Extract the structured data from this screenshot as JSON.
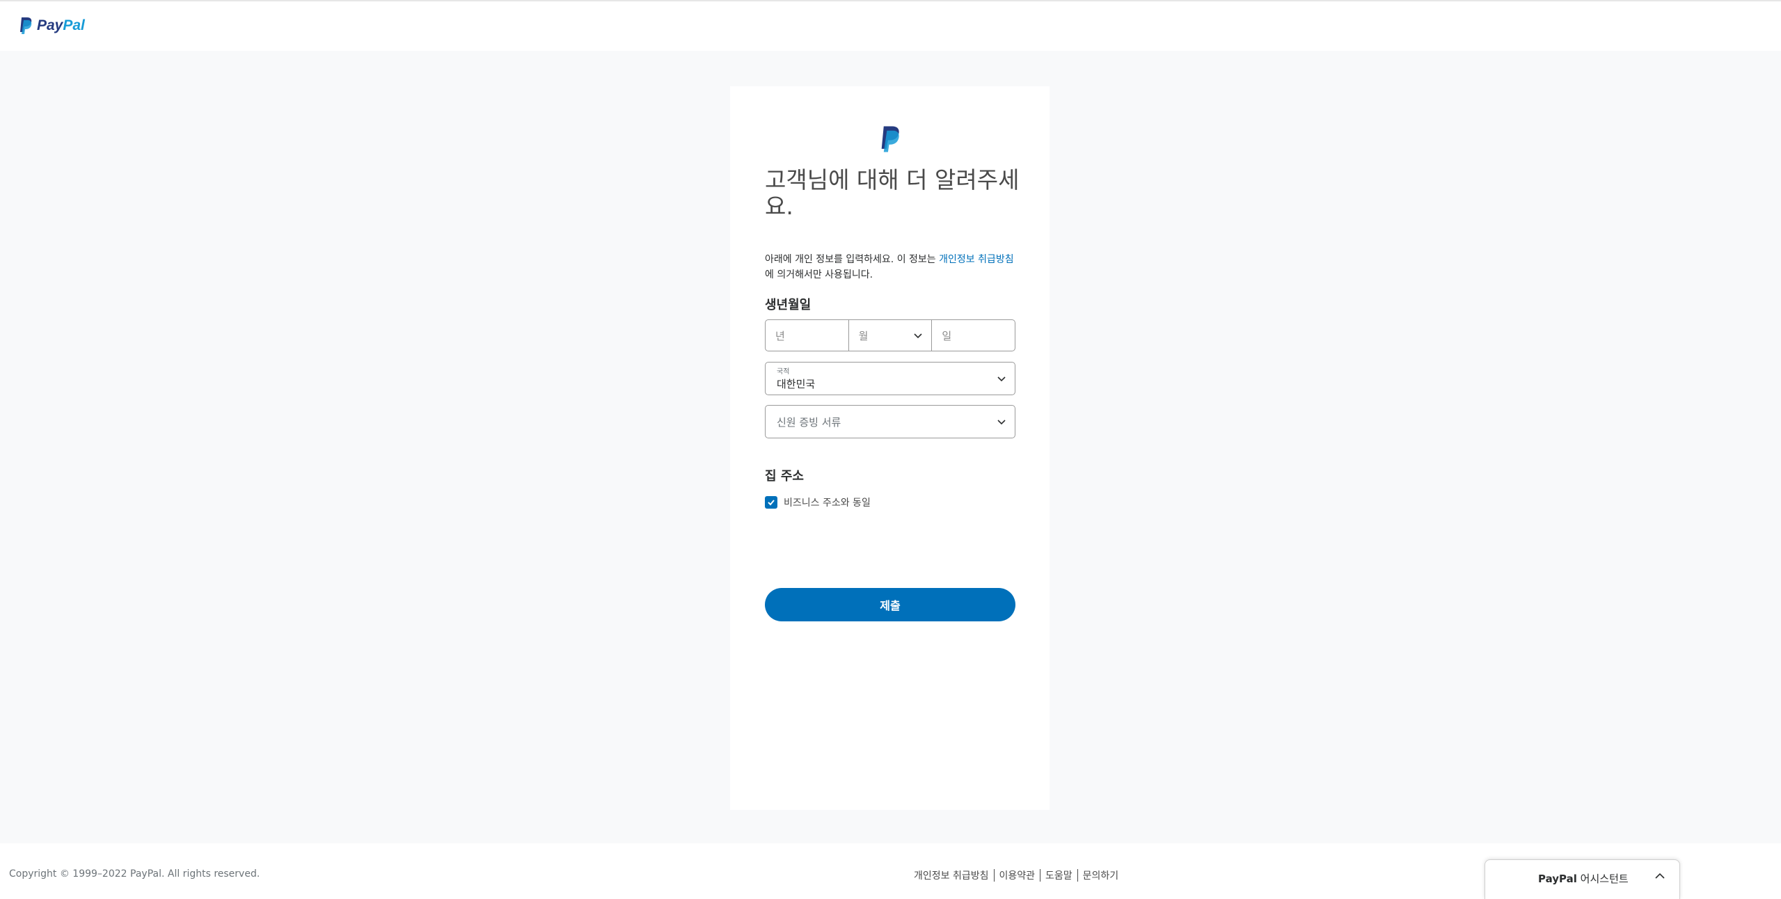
{
  "header": {
    "logo_text_pay": "Pay",
    "logo_text_pal": "Pal"
  },
  "colors": {
    "brand_blue": "#0070ba",
    "logo_dark": "#253b80",
    "logo_light": "#179bd7",
    "background": "#f8f9fa"
  },
  "form": {
    "title": "고객님에 대해 더 알려주세요.",
    "desc_before": "아래에 개인 정보를 입력하세요. 이 정보는 ",
    "desc_link": "개인정보 취급방침",
    "desc_after": "에 의거해서만 사용됩니다.",
    "dob_label": "생년월일",
    "dob_year_placeholder": "년",
    "dob_month_placeholder": "월",
    "dob_day_placeholder": "일",
    "nationality_label": "국적",
    "nationality_value": "대한민국",
    "id_doc_placeholder": "신원 증빙 서류",
    "home_address_label": "집 주소",
    "same_as_business_label": "비즈니스 주소와 동일",
    "same_as_business_checked": true,
    "submit_label": "제출"
  },
  "footer": {
    "copyright": "Copyright © 1999–2022 PayPal. All rights reserved.",
    "links": [
      "개인정보 취급방침",
      "이용약관",
      "도움말",
      "문의하기"
    ]
  },
  "assistant": {
    "brand": "PayPal",
    "label": "어시스턴트"
  },
  "icons": [
    "paypal-logo-icon",
    "chevron-down-icon",
    "check-icon",
    "chevron-up-icon"
  ]
}
